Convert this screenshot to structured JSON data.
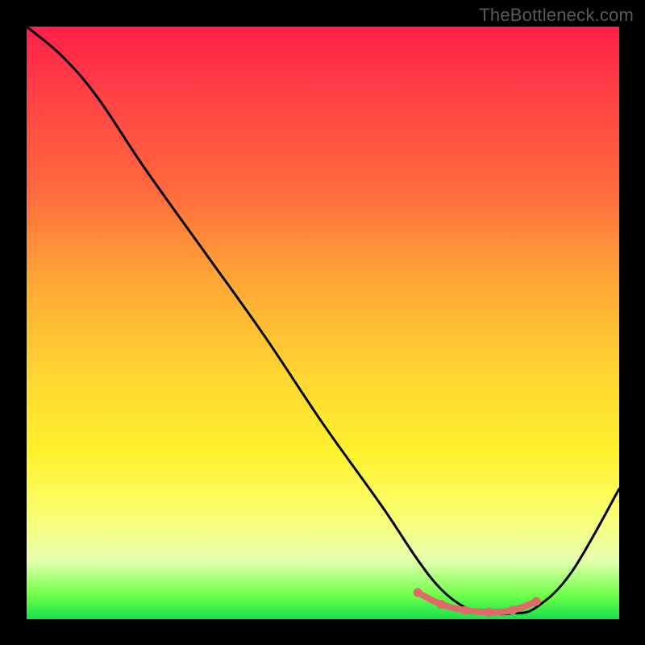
{
  "watermark": "TheBottleneck.com",
  "chart_data": {
    "type": "line",
    "title": "",
    "xlabel": "",
    "ylabel": "",
    "xlim": [
      0,
      100
    ],
    "ylim": [
      0,
      100
    ],
    "grid": false,
    "legend": false,
    "series": [
      {
        "name": "curve",
        "color": "#000000",
        "x": [
          0,
          6,
          12,
          20,
          30,
          40,
          50,
          60,
          66,
          70,
          74,
          78,
          82,
          86,
          92,
          100
        ],
        "y": [
          100,
          95,
          88,
          76,
          62,
          48,
          33,
          19,
          10,
          5,
          2,
          1,
          1,
          2,
          8,
          22
        ]
      },
      {
        "name": "bottom-highlight",
        "color": "#e06a6a",
        "x": [
          66,
          70,
          74,
          78,
          82,
          86
        ],
        "y": [
          4.5,
          2.5,
          1.5,
          1.2,
          1.5,
          3.0
        ]
      }
    ],
    "annotations": []
  }
}
